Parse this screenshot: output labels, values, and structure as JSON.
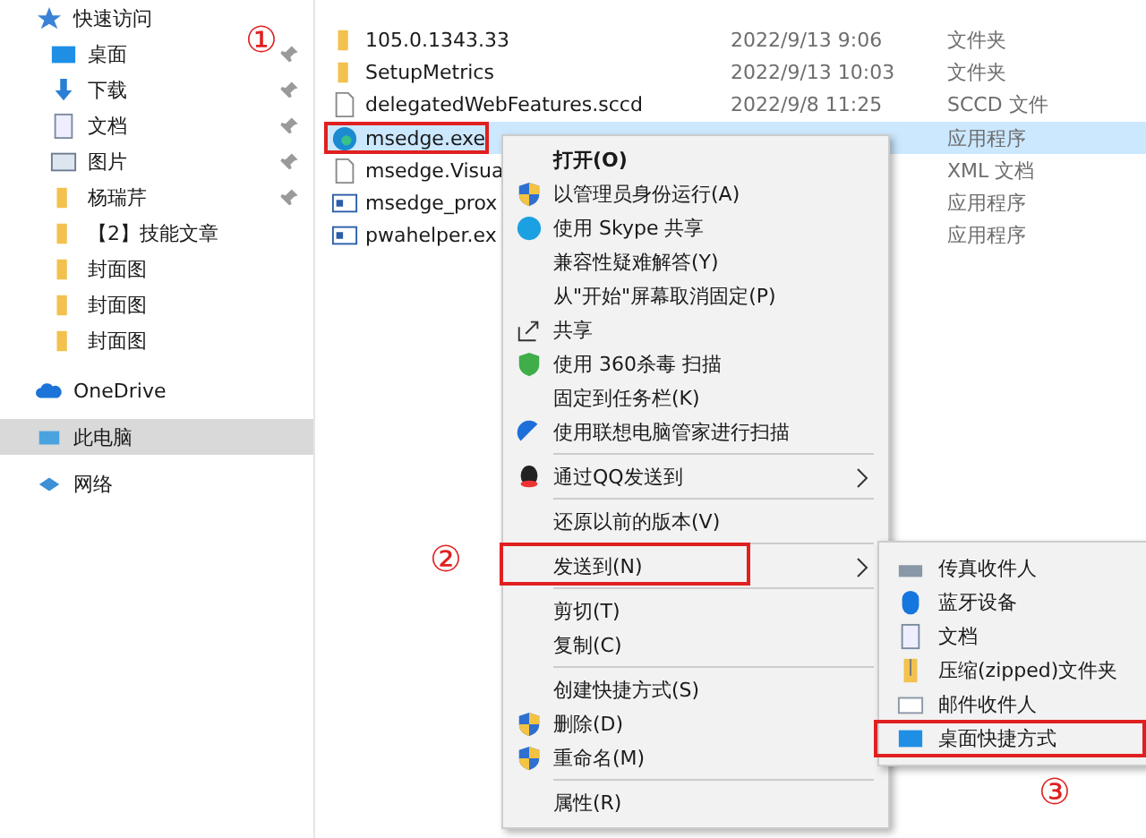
{
  "sidebar": {
    "items": [
      {
        "label": "快速访问",
        "selected": false,
        "children": [
          {
            "label": "桌面",
            "pinned": true
          },
          {
            "label": "下载",
            "pinned": true
          },
          {
            "label": "文档",
            "pinned": true
          },
          {
            "label": "图片",
            "pinned": true
          },
          {
            "label": "杨瑞芹",
            "pinned": true
          },
          {
            "label": "【2】技能文章",
            "pinned": false
          },
          {
            "label": "封面图",
            "pinned": false
          },
          {
            "label": "封面图",
            "pinned": false
          },
          {
            "label": "封面图",
            "pinned": false
          }
        ]
      },
      {
        "label": "OneDrive",
        "selected": false
      },
      {
        "label": "此电脑",
        "selected": true
      },
      {
        "label": "网络",
        "selected": false
      }
    ]
  },
  "files": [
    {
      "name": "105.0.1343.33",
      "date": "2022/9/13 9:06",
      "type": "文件夹",
      "selected": false,
      "annotated": false
    },
    {
      "name": "SetupMetrics",
      "date": "2022/9/13 10:03",
      "type": "文件夹",
      "selected": false,
      "annotated": false
    },
    {
      "name": "delegatedWebFeatures.sccd",
      "date": "2022/9/8 11:25",
      "type": "SCCD 文件",
      "selected": false,
      "annotated": false
    },
    {
      "name": "msedge.exe",
      "type": "应用程序",
      "selected": true,
      "annotated": true
    },
    {
      "name": "msedge.Visua",
      "type": "XML 文档",
      "selected": false,
      "annotated": false
    },
    {
      "name": "msedge_prox",
      "type": "应用程序",
      "selected": false,
      "annotated": false
    },
    {
      "name": "pwahelper.ex",
      "type": "应用程序",
      "selected": false,
      "annotated": false
    }
  ],
  "context_menu": {
    "items": [
      {
        "kind": "default",
        "label": "打开(O)"
      },
      {
        "kind": "item",
        "label": "以管理员身份运行(A)"
      },
      {
        "kind": "item",
        "label": "使用 Skype 共享"
      },
      {
        "kind": "item",
        "label": "兼容性疑难解答(Y)"
      },
      {
        "kind": "item",
        "label": "从\"开始\"屏幕取消固定(P)"
      },
      {
        "kind": "item",
        "label": "共享"
      },
      {
        "kind": "item",
        "label": "使用 360杀毒 扫描"
      },
      {
        "kind": "item",
        "label": "固定到任务栏(K)"
      },
      {
        "kind": "item",
        "label": "使用联想电脑管家进行扫描"
      },
      {
        "kind": "separator"
      },
      {
        "kind": "item",
        "label": "通过QQ发送到",
        "submenu": true
      },
      {
        "kind": "separator"
      },
      {
        "kind": "item",
        "label": "还原以前的版本(V)"
      },
      {
        "kind": "separator"
      },
      {
        "kind": "item",
        "label": "发送到(N)",
        "submenu": true,
        "annotated": true
      },
      {
        "kind": "separator"
      },
      {
        "kind": "item",
        "label": "剪切(T)"
      },
      {
        "kind": "item",
        "label": "复制(C)"
      },
      {
        "kind": "separator"
      },
      {
        "kind": "item",
        "label": "创建快捷方式(S)"
      },
      {
        "kind": "item",
        "label": "删除(D)"
      },
      {
        "kind": "item",
        "label": "重命名(M)"
      },
      {
        "kind": "separator"
      },
      {
        "kind": "item",
        "label": "属性(R)"
      }
    ]
  },
  "send_to_menu": {
    "items": [
      {
        "label": "传真收件人",
        "annotated": false
      },
      {
        "label": "蓝牙设备",
        "annotated": false
      },
      {
        "label": "文档",
        "annotated": false
      },
      {
        "label": "压缩(zipped)文件夹",
        "annotated": false
      },
      {
        "label": "邮件收件人",
        "annotated": false
      },
      {
        "label": "桌面快捷方式",
        "annotated": true
      }
    ]
  },
  "annotations": [
    {
      "label": "①"
    },
    {
      "label": "②"
    },
    {
      "label": "③"
    }
  ]
}
